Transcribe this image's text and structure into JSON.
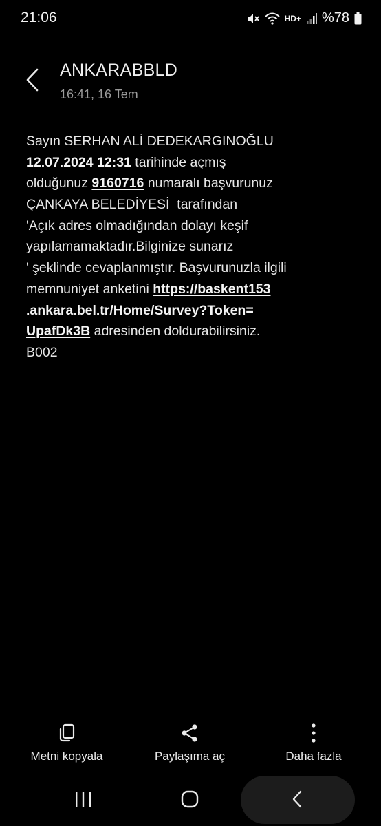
{
  "status_bar": {
    "time": "21:06",
    "network_label": "HD+",
    "battery_level": "%78"
  },
  "header": {
    "sender": "ANKARABBLD",
    "timestamp": "16:41, 16 Tem"
  },
  "message": {
    "lines": [
      [
        "Sayın SERHAN ALİ DEDEKARGINOĞLU"
      ],
      [
        "12.07.2024 12:31",
        " tarihinde açmış"
      ],
      [
        "olduğunuz ",
        "9160716",
        " numaralı başvurunuz"
      ],
      [
        "ÇANKAYA BELEDİYESİ  tarafından"
      ],
      [
        "'Açık adres olmadığından dolayı keşif"
      ],
      [
        "yapılamamaktadır.Bilginize sunarız"
      ],
      [
        "' şeklinde cevaplanmıştır. Başvurunuzla ilgili"
      ],
      [
        "memnuniyet anketini ",
        "https://baskent153"
      ],
      [
        ".ankara.bel.tr/Home/Survey?Token="
      ],
      [
        "UpafDk3B",
        " adresinden doldurabilirsiniz."
      ],
      [
        "B002"
      ]
    ]
  },
  "actions": {
    "copy_label": "Metni kopyala",
    "share_label": "Paylaşıma aç",
    "more_label": "Daha fazla"
  }
}
